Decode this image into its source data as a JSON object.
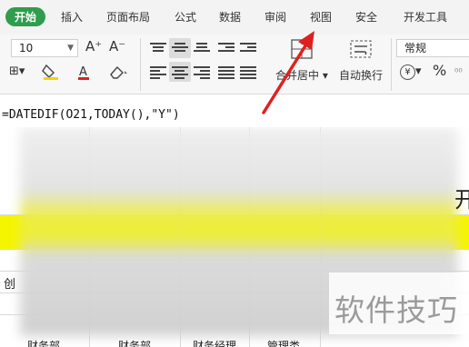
{
  "menu": {
    "tabs": [
      "开始",
      "插入",
      "页面布局",
      "公式",
      "数据",
      "审阅",
      "视图",
      "安全",
      "开发工具"
    ],
    "active_tab": "开始"
  },
  "ribbon": {
    "font_size": "10",
    "grow_font": "A⁺",
    "shrink_font": "A⁻",
    "merge_center": "合并居中",
    "wrap_text": "自动换行",
    "number_format": "常规",
    "currency_symbol": "¥",
    "percent_symbol": "%"
  },
  "formula_bar": {
    "formula": "=DATEDIF(O21,TODAY(),\"Y\")"
  },
  "sheet": {
    "partial_cell_left": "创",
    "partial_cell_right": "开",
    "footer_cells": [
      "财务部",
      "财务部",
      "财务经理",
      "管理类"
    ]
  },
  "watermark": "软件技巧",
  "colors": {
    "active_tab_bg": "#2f9d4b",
    "highlight_row": "#f5f500",
    "annotation_arrow": "#e02020"
  }
}
